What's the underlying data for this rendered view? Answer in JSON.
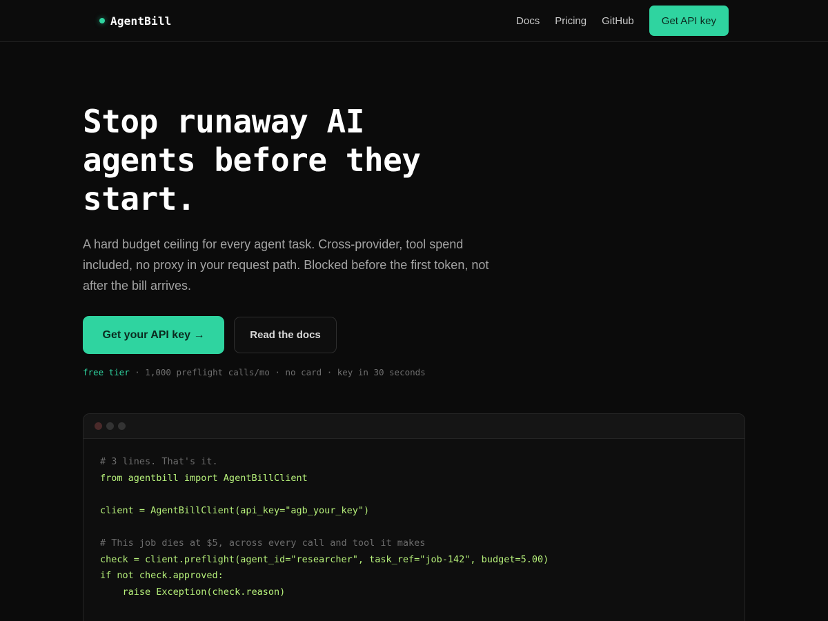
{
  "nav": {
    "brand": "AgentBill",
    "links": [
      "Docs",
      "Pricing",
      "GitHub"
    ],
    "cta": "Get API key"
  },
  "hero": {
    "title_lines": [
      "Stop runaway AI",
      "agents before they",
      "start."
    ],
    "subtitle": "A hard budget ceiling for every agent task. Cross-provider, tool spend included, no proxy in your request path. Blocked before the first token, not after the bill arrives.",
    "primary_cta": "Get your API key →",
    "secondary_cta": "Read the docs",
    "meta": {
      "highlight": "free tier",
      "rest": " · 1,000 preflight calls/mo · no card · key in 30 seconds"
    }
  },
  "code": {
    "lines": [
      {
        "type": "comment",
        "text": "# 3 lines. That's it."
      },
      {
        "type": "code",
        "text": "from agentbill import AgentBillClient"
      },
      {
        "type": "code",
        "text": ""
      },
      {
        "type": "code",
        "text": "client = AgentBillClient(api_key=\"agb_your_key\")"
      },
      {
        "type": "code",
        "text": ""
      },
      {
        "type": "comment",
        "text": "# This job dies at $5, across every call and tool it makes"
      },
      {
        "type": "code",
        "text": "check = client.preflight(agent_id=\"researcher\", task_ref=\"job-142\", budget=5.00)"
      },
      {
        "type": "code",
        "text": "if not check.approved:"
      },
      {
        "type": "code",
        "text": "    raise Exception(check.reason)"
      }
    ]
  },
  "colors": {
    "accent": "#2fd4a0",
    "background": "#0b0b0b",
    "code_green": "#b6f07a",
    "comment": "#6b6b6b"
  }
}
